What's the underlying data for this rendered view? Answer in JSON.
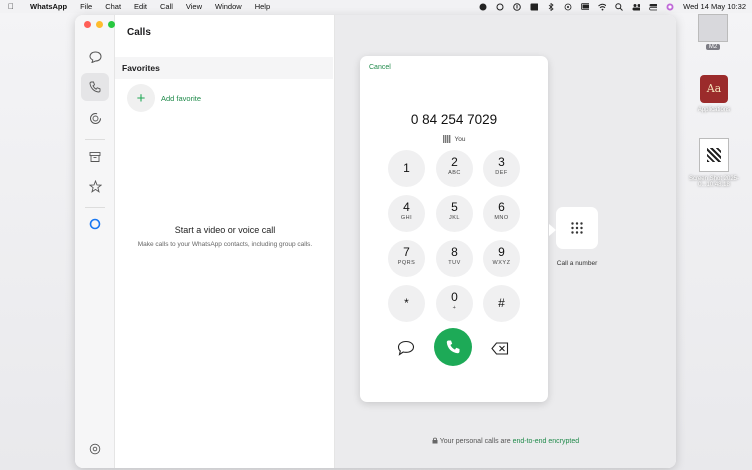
{
  "menubar": {
    "app": "WhatsApp",
    "menus": [
      "File",
      "Chat",
      "Edit",
      "Call",
      "View",
      "Window",
      "Help"
    ],
    "clock": "Wed 14 May  10:32"
  },
  "desktop": {
    "items": [
      {
        "label": "M2"
      },
      {
        "label": "Applications",
        "glyph": "Aa"
      },
      {
        "label": "Screen Shot 2025-0...10.48.18"
      }
    ]
  },
  "calls": {
    "title": "Calls",
    "favorites_header": "Favorites",
    "add_favorite": "Add favorite",
    "empty_title": "Start a video or voice call",
    "empty_subtitle": "Make calls to your WhatsApp contacts, including group calls."
  },
  "dialer": {
    "cancel": "Cancel",
    "number": "0 84 254 7029",
    "you": "You",
    "keys": [
      {
        "d": "1",
        "l": ""
      },
      {
        "d": "2",
        "l": "ABC"
      },
      {
        "d": "3",
        "l": "DEF"
      },
      {
        "d": "4",
        "l": "GHI"
      },
      {
        "d": "5",
        "l": "JKL"
      },
      {
        "d": "6",
        "l": "MNO"
      },
      {
        "d": "7",
        "l": "PQRS"
      },
      {
        "d": "8",
        "l": "TUV"
      },
      {
        "d": "9",
        "l": "WXYZ"
      },
      {
        "d": "*",
        "l": ""
      },
      {
        "d": "0",
        "l": "+"
      },
      {
        "d": "#",
        "l": ""
      }
    ]
  },
  "call_a_number": "Call a number",
  "encrypted": {
    "prefix": "Your personal calls are ",
    "highlight": "end-to-end encrypted"
  },
  "colors": {
    "accent": "#1daa57",
    "link": "#1f8a4a"
  }
}
